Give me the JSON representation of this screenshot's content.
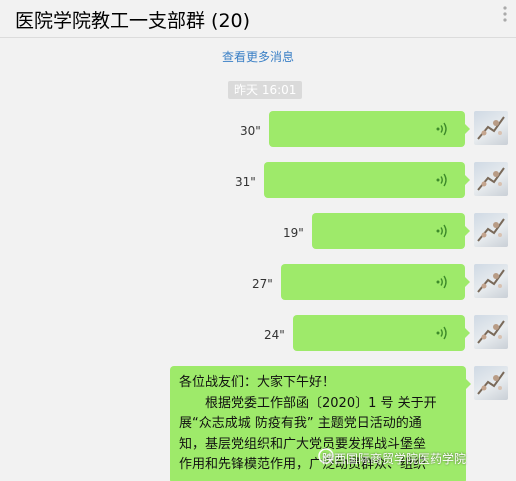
{
  "header": {
    "title": "医院学院教工一支部群 (20)",
    "more_icon": "more-dots-icon"
  },
  "chat": {
    "load_more": "查看更多消息",
    "timestamp": "昨天 16:01",
    "voice_messages": [
      {
        "duration": "30\""
      },
      {
        "duration": "31\""
      },
      {
        "duration": "19\""
      },
      {
        "duration": "27\""
      },
      {
        "duration": "24\""
      }
    ],
    "text_message": {
      "lines": [
        "各位战友们：大家下午好！",
        "　　根据党委工作部函〔2020〕1 号 关于开",
        "展“众志成城 防疫有我” 主题党日活动的通",
        "知，基层党组织和广大党员要发挥战斗堡垒",
        "作用和先锋模范作用，广泛动员群众、组织"
      ]
    },
    "colors": {
      "bubble": "#9eea6a",
      "link": "#3b80c6",
      "background": "#f2f2f2"
    }
  },
  "watermark": {
    "text": "陕西国际商贸学院医药学院"
  }
}
